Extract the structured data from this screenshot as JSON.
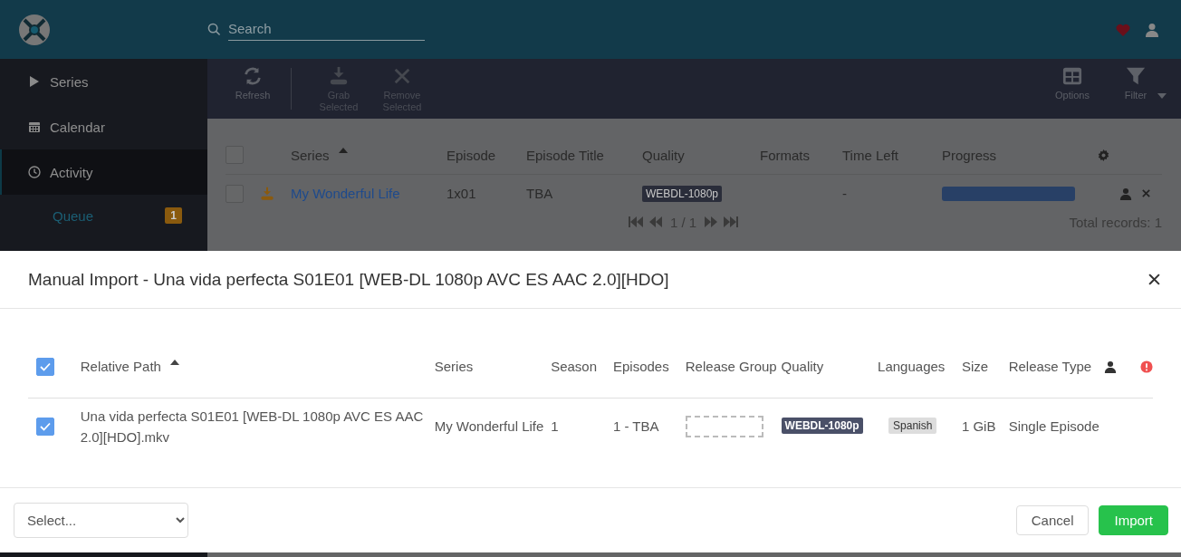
{
  "header": {
    "search": {
      "placeholder": "Search"
    }
  },
  "sidebar": {
    "items": [
      {
        "label": "Series",
        "selected": false
      },
      {
        "label": "Calendar",
        "selected": false
      },
      {
        "label": "Activity",
        "selected": true,
        "children": [
          {
            "label": "Queue",
            "badge": "1",
            "selected": true
          }
        ]
      }
    ]
  },
  "toolbar": {
    "left": [
      {
        "label": "Refresh",
        "disabled": false
      },
      {
        "label": "Grab Selected",
        "disabled": true
      },
      {
        "label": "Remove Selected",
        "disabled": true
      }
    ],
    "right": [
      {
        "label": "Options",
        "disabled": false,
        "menu": false
      },
      {
        "label": "Filter",
        "disabled": false,
        "menu": true
      }
    ]
  },
  "queue": {
    "all_checked": false,
    "columns": [
      {
        "label": "Series",
        "sorted": true
      },
      {
        "label": "Episode",
        "sorted": false
      },
      {
        "label": "Episode Title",
        "sorted": false
      },
      {
        "label": "Quality",
        "sorted": false
      },
      {
        "label": "Formats",
        "sorted": false
      },
      {
        "label": "Time Left",
        "sorted": false
      },
      {
        "label": "Progress",
        "sorted": false
      }
    ],
    "rows": [
      {
        "checked": false,
        "series": "My Wonderful Life",
        "episode": "1x01",
        "episode_title": "TBA",
        "quality": "WEBDL-1080p",
        "time_left": "-",
        "level": 1
      }
    ],
    "pagination": {
      "page": "1 / 1",
      "total": "Total records: 1"
    }
  },
  "modal": {
    "title": "Manual Import - Una vida perfecta S01E01 [WEB-DL 1080p AVC ES AAC 2.0][HDO]",
    "all_checked": true,
    "columns": [
      {
        "label": "Relative Path",
        "sorted": true
      },
      {
        "label": "Series",
        "sorted": false
      },
      {
        "label": "Season",
        "sorted": false
      },
      {
        "label": "Episodes",
        "sorted": false
      },
      {
        "label": "Release Group",
        "sorted": false
      },
      {
        "label": "Quality",
        "sorted": false
      },
      {
        "label": "Languages",
        "sorted": false
      },
      {
        "label": "Size",
        "sorted": false
      },
      {
        "label": "Release Type",
        "sorted": false
      }
    ],
    "rows": [
      {
        "checked": true,
        "relative_path": "Una vida perfecta S01E01 [WEB-DL 1080p AVC ES AAC 2.0][HDO].mkv",
        "series": "My Wonderful Life",
        "season": "1",
        "episodes": "1 - TBA",
        "quality": "WEBDL-1080p",
        "languages": [
          "Spanish"
        ],
        "size": "1 GiB",
        "release_type": "Single Episode"
      }
    ],
    "select": {
      "placeholder": "Select..."
    },
    "buttons": [
      {
        "label": "Cancel",
        "kind": "default"
      },
      {
        "label": "Import",
        "kind": "success"
      }
    ]
  }
}
